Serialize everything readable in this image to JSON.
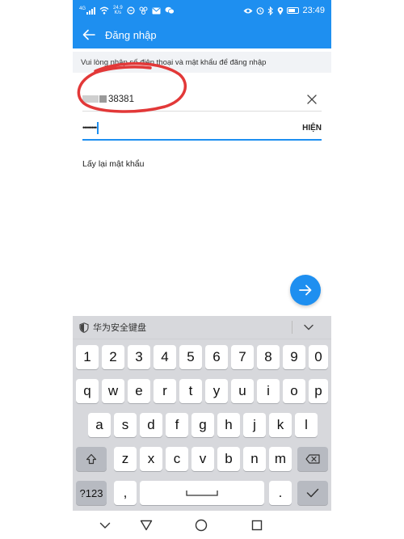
{
  "status_bar": {
    "carrier_label": "4G",
    "net_speed_value": "24.9",
    "net_speed_unit": "K/s",
    "time": "23:49",
    "icons": [
      "signal-icon",
      "wifi-icon",
      "notification-icon",
      "messenger-icon",
      "mail-icon",
      "chat-icon",
      "eye-icon",
      "alarm-icon",
      "bluetooth-icon",
      "location-icon",
      "battery-icon"
    ]
  },
  "app_bar": {
    "title": "Đăng nhập",
    "back_icon": "arrow-left-icon",
    "color": "#1e8ff0"
  },
  "hint": {
    "text": "Vui lòng nhập số điện thoại và mật khẩu để đăng nhập"
  },
  "phone_field": {
    "visible_digits": "38381",
    "clear_icon": "close-icon"
  },
  "password_field": {
    "value": "••••••••",
    "show_label": "HIỆN"
  },
  "forgot_password": {
    "label": "Lấy lại mật khẩu"
  },
  "submit_button": {
    "icon": "arrow-right-icon"
  },
  "keyboard": {
    "title": "华为安全键盘",
    "shield_icon": "shield-icon",
    "collapse_icon": "chevron-down-icon",
    "row_numbers": [
      "1",
      "2",
      "3",
      "4",
      "5",
      "6",
      "7",
      "8",
      "9",
      "0"
    ],
    "row_top": [
      "q",
      "w",
      "e",
      "r",
      "t",
      "y",
      "u",
      "i",
      "o",
      "p"
    ],
    "row_home": [
      "a",
      "s",
      "d",
      "f",
      "g",
      "h",
      "j",
      "k",
      "l"
    ],
    "row_bottom": [
      "z",
      "x",
      "c",
      "v",
      "b",
      "n",
      "m"
    ],
    "symbols_label": "?123",
    "comma_label": ",",
    "period_label": "."
  },
  "nav_bar": {
    "icons": [
      "nav-collapse-icon",
      "nav-back-icon",
      "nav-home-icon",
      "nav-recents-icon"
    ]
  }
}
